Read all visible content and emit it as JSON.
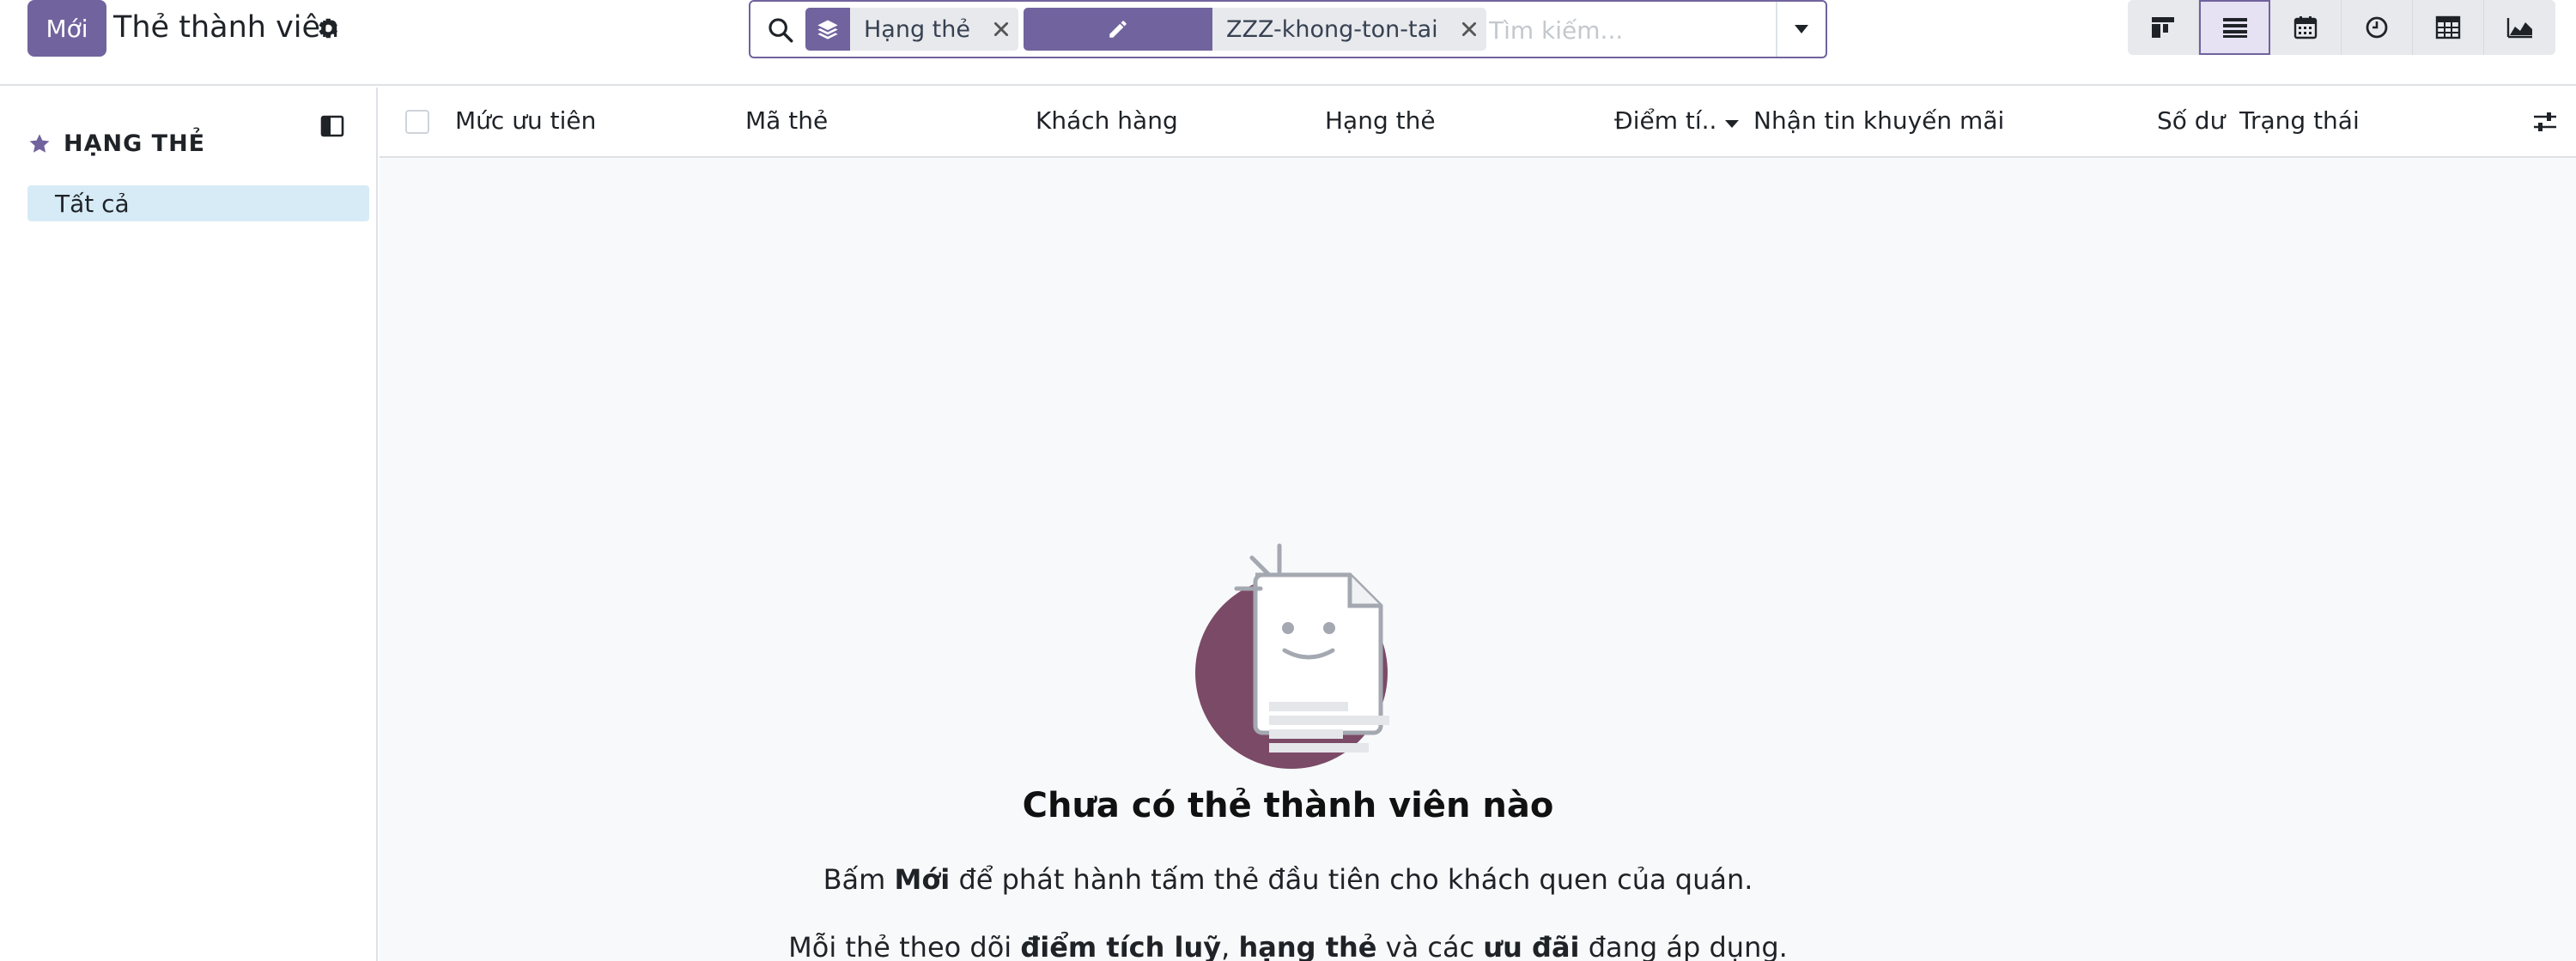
{
  "control_panel": {
    "new_button": "Mới",
    "title": "Thẻ thành viên",
    "search": {
      "facets": [
        {
          "label": "Hạng thẻ",
          "icon": "layers-icon"
        },
        {
          "label": "ZZZ-khong-ton-tai",
          "icon": "pencil-icon"
        }
      ],
      "placeholder": "Tìm kiếm..."
    },
    "views": [
      "kanban-icon",
      "list-icon",
      "calendar-icon",
      "activity-icon",
      "pivot-icon",
      "graph-icon"
    ],
    "active_view": "list"
  },
  "search_panel": {
    "heading": "HẠNG THẺ",
    "items": [
      {
        "label": "Tất cả",
        "active": true
      }
    ]
  },
  "list": {
    "columns": [
      "Mức ưu tiên",
      "Mã thẻ",
      "Khách hàng",
      "Hạng thẻ",
      "Điểm tí..",
      "Nhận tin khuyến mãi",
      "Số dư",
      "Trạng thái"
    ]
  },
  "empty_state": {
    "title": "Chưa có thẻ thành viên nào",
    "line1": {
      "a": "Bấm ",
      "b": "Mới",
      "c": " để phát hành tấm thẻ đầu tiên cho khách quen của quán."
    },
    "line2": {
      "a": "Mỗi thẻ theo dõi ",
      "b": "điểm tích luỹ",
      "c": ", ",
      "d": "hạng thẻ",
      "e": " và các ",
      "f": "ưu đãi",
      "g": " đang áp dụng."
    }
  },
  "colors": {
    "brand": "#71639e",
    "active_item": "#d7ebf6",
    "illustration_circle": "#7b4a67"
  }
}
